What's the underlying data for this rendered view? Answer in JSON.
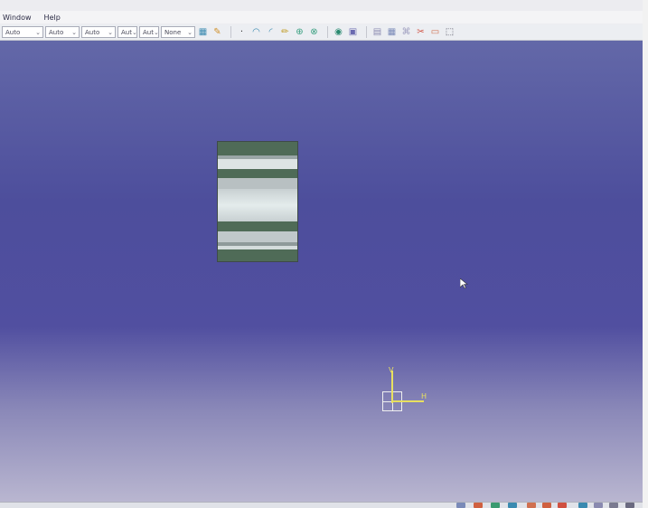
{
  "menu": {
    "window": "Window",
    "help": "Help"
  },
  "toolbar": {
    "combos": [
      {
        "value": "Auto",
        "width": 46
      },
      {
        "value": "Auto",
        "width": 38
      },
      {
        "value": "Auto",
        "width": 38
      },
      {
        "value": "Aut",
        "width": 22
      },
      {
        "value": "Aut",
        "width": 22
      },
      {
        "value": "None",
        "width": 38
      }
    ],
    "icons_group1": [
      "pattern-icon",
      "paint-icon"
    ],
    "icons_group2": [
      "point-icon",
      "arc-icon",
      "arc-alt-icon",
      "pencil-icon",
      "zoom-icon",
      "zoom-area-icon",
      "render-icon",
      "cube-icon"
    ],
    "icons_group3": [
      "grid-icon",
      "snap-icon",
      "constraint-icon",
      "dimension-icon",
      "select-icon"
    ]
  },
  "colors": {
    "viewport_top": "#6368a8",
    "viewport_mid": "#514fa0",
    "viewport_bottom": "#b9b6d0",
    "axis": "#e8e060",
    "part_dark": "#4f6b57",
    "part_light": "#d8e0e0"
  },
  "axis": {
    "vertical_label": "V",
    "horizontal_label": "H"
  }
}
